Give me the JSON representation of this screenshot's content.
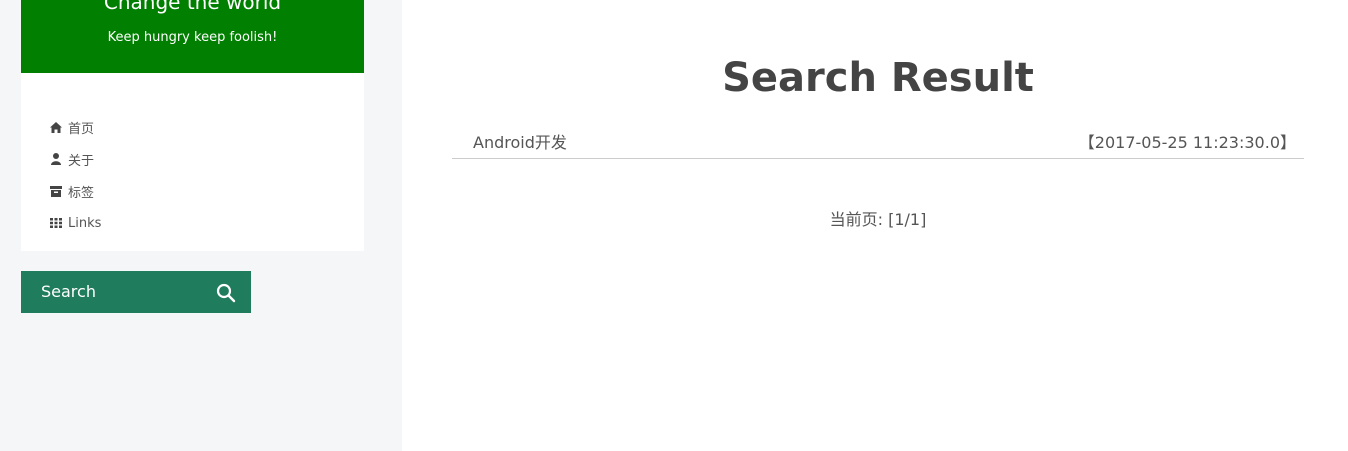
{
  "sidebar": {
    "header": {
      "title": "Change the world",
      "subtitle": "Keep hungry keep foolish!"
    },
    "nav": [
      {
        "label": "首页",
        "icon": "home-icon"
      },
      {
        "label": "关于",
        "icon": "user-icon"
      },
      {
        "label": "标签",
        "icon": "archive-icon"
      },
      {
        "label": "Links",
        "icon": "grid-icon"
      }
    ],
    "search": {
      "label": "Search",
      "icon": "search-icon"
    }
  },
  "main": {
    "title": "Search Result",
    "results": [
      {
        "title": "Android开发",
        "date": "【2017-05-25 11:23:30.0】"
      }
    ],
    "pager": "当前页: [1/1]"
  },
  "colors": {
    "header_bg": "#007f00",
    "search_bg": "#1f7c5d",
    "sidebar_bg": "#f5f6f8",
    "text": "#555555"
  }
}
